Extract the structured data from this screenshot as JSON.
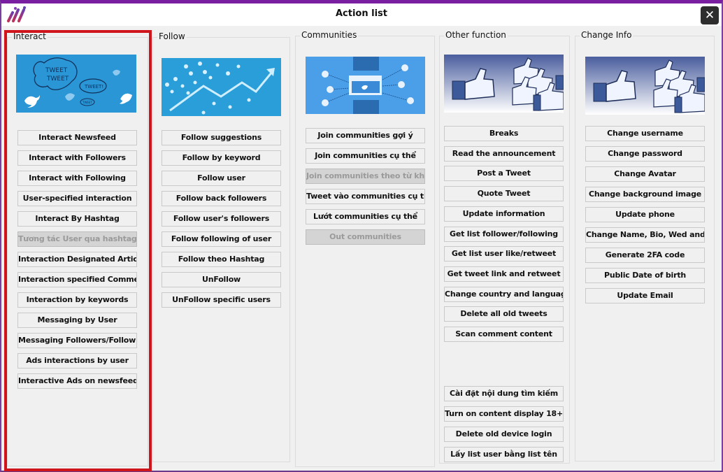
{
  "window": {
    "title": "Action list",
    "logo_icon": "app-logo-icon",
    "close_icon": "close-icon",
    "accent_color": "#7a1fa2",
    "highlight_color": "#d0141c"
  },
  "groups": [
    {
      "title": "Interact",
      "banner": "twitter-tweet-tweet-banner",
      "buttons": [
        {
          "label": "Interact Newsfeed",
          "disabled": false
        },
        {
          "label": "Interact with Followers",
          "disabled": false
        },
        {
          "label": "Interact with Following",
          "disabled": false
        },
        {
          "label": "User-specified interaction",
          "disabled": false
        },
        {
          "label": "Interact By Hashtag",
          "disabled": false
        },
        {
          "label": "Tương tác User qua hashtag",
          "disabled": true
        },
        {
          "label": "Interaction Designated Articles",
          "disabled": false
        },
        {
          "label": "Interaction specified Comment",
          "disabled": false
        },
        {
          "label": "Interaction by keywords",
          "disabled": false
        },
        {
          "label": "Messaging by User",
          "disabled": false
        },
        {
          "label": "Messaging Followers/Followi...",
          "disabled": false
        },
        {
          "label": "Ads interactions by user",
          "disabled": false
        },
        {
          "label": "Interactive Ads on newsfeed",
          "disabled": false
        }
      ]
    },
    {
      "title": "Follow",
      "banner": "twitter-growth-banner",
      "buttons": [
        {
          "label": "Follow suggestions",
          "disabled": false
        },
        {
          "label": "Follow by keyword",
          "disabled": false
        },
        {
          "label": "Follow user",
          "disabled": false
        },
        {
          "label": "Follow back followers",
          "disabled": false
        },
        {
          "label": "Follow user's followers",
          "disabled": false
        },
        {
          "label": "Follow following of user",
          "disabled": false
        },
        {
          "label": "Follow theo Hashtag",
          "disabled": false
        },
        {
          "label": "UnFollow",
          "disabled": false
        },
        {
          "label": "UnFollow specific users",
          "disabled": false
        }
      ]
    },
    {
      "title": "Communities",
      "banner": "twitter-communities-banner",
      "buttons": [
        {
          "label": "Join communities gợi ý",
          "disabled": false
        },
        {
          "label": "Join communities cụ thể",
          "disabled": false
        },
        {
          "label": "Join communities theo từ khóa",
          "disabled": true
        },
        {
          "label": "Tweet vào communities cụ thể",
          "disabled": false
        },
        {
          "label": "Lướt communities cụ thể",
          "disabled": false
        },
        {
          "label": "Out communities",
          "disabled": true
        }
      ]
    },
    {
      "title": "Other function",
      "banner": "thumbs-up-banner",
      "buttons": [
        {
          "label": "Breaks",
          "disabled": false
        },
        {
          "label": "Read the announcement",
          "disabled": false
        },
        {
          "label": "Post a Tweet",
          "disabled": false
        },
        {
          "label": "Quote  Tweet",
          "disabled": false
        },
        {
          "label": "Update information",
          "disabled": false
        },
        {
          "label": "Get list follower/following",
          "disabled": false
        },
        {
          "label": "Get list user like/retweet",
          "disabled": false
        },
        {
          "label": "Get tweet link and retweet",
          "disabled": false
        },
        {
          "label": "Change country and language",
          "disabled": false
        },
        {
          "label": "Delete all old tweets",
          "disabled": false
        },
        {
          "label": "Scan comment content",
          "disabled": false
        }
      ],
      "bottom_buttons": [
        {
          "label": "Cài đặt nội dung tìm kiếm",
          "disabled": false
        },
        {
          "label": "Turn on content display 18+",
          "disabled": false
        },
        {
          "label": "Delete old device login",
          "disabled": false
        },
        {
          "label": "Lấy list user bằng list tên",
          "disabled": false
        }
      ]
    },
    {
      "title": "Change Info",
      "banner": "thumbs-up-banner",
      "buttons": [
        {
          "label": "Change username",
          "disabled": false
        },
        {
          "label": "Change password",
          "disabled": false
        },
        {
          "label": "Change Avatar",
          "disabled": false
        },
        {
          "label": "Change background image",
          "disabled": false
        },
        {
          "label": "Update phone",
          "disabled": false
        },
        {
          "label": "Change Name, Bio, Wed and ...",
          "disabled": false
        },
        {
          "label": "Generate 2FA code",
          "disabled": false
        },
        {
          "label": "Public Date of birth",
          "disabled": false
        },
        {
          "label": "Update Email",
          "disabled": false
        }
      ]
    }
  ]
}
